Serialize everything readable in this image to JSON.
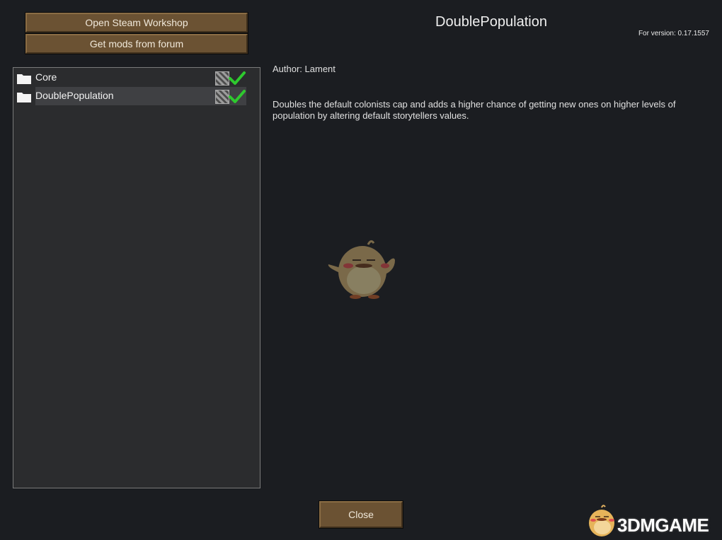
{
  "top_buttons": {
    "workshop_label": "Open Steam Workshop",
    "forum_label": "Get mods from forum"
  },
  "mod_list": {
    "items": [
      {
        "name": "Core",
        "selected": false,
        "active": true
      },
      {
        "name": "DoublePopulation",
        "selected": true,
        "active": true
      }
    ]
  },
  "details": {
    "title": "DoublePopulation",
    "version": "For version: 0.17.1557",
    "author": "Author: Lament",
    "description": "Doubles the default colonists cap and adds a higher chance of getting new ones on higher levels of population by altering default storytellers values."
  },
  "footer": {
    "close_label": "Close"
  },
  "watermark": {
    "text": "3DMGAME"
  },
  "colors": {
    "background": "#1b1d21",
    "button_brown": "#6b5233",
    "panel": "#2b2c2e",
    "check_green": "#2ec92e"
  },
  "icons": {
    "folder": "folder-icon",
    "disabled_hatch": "hatch-icon",
    "active": "checkmark-icon"
  }
}
